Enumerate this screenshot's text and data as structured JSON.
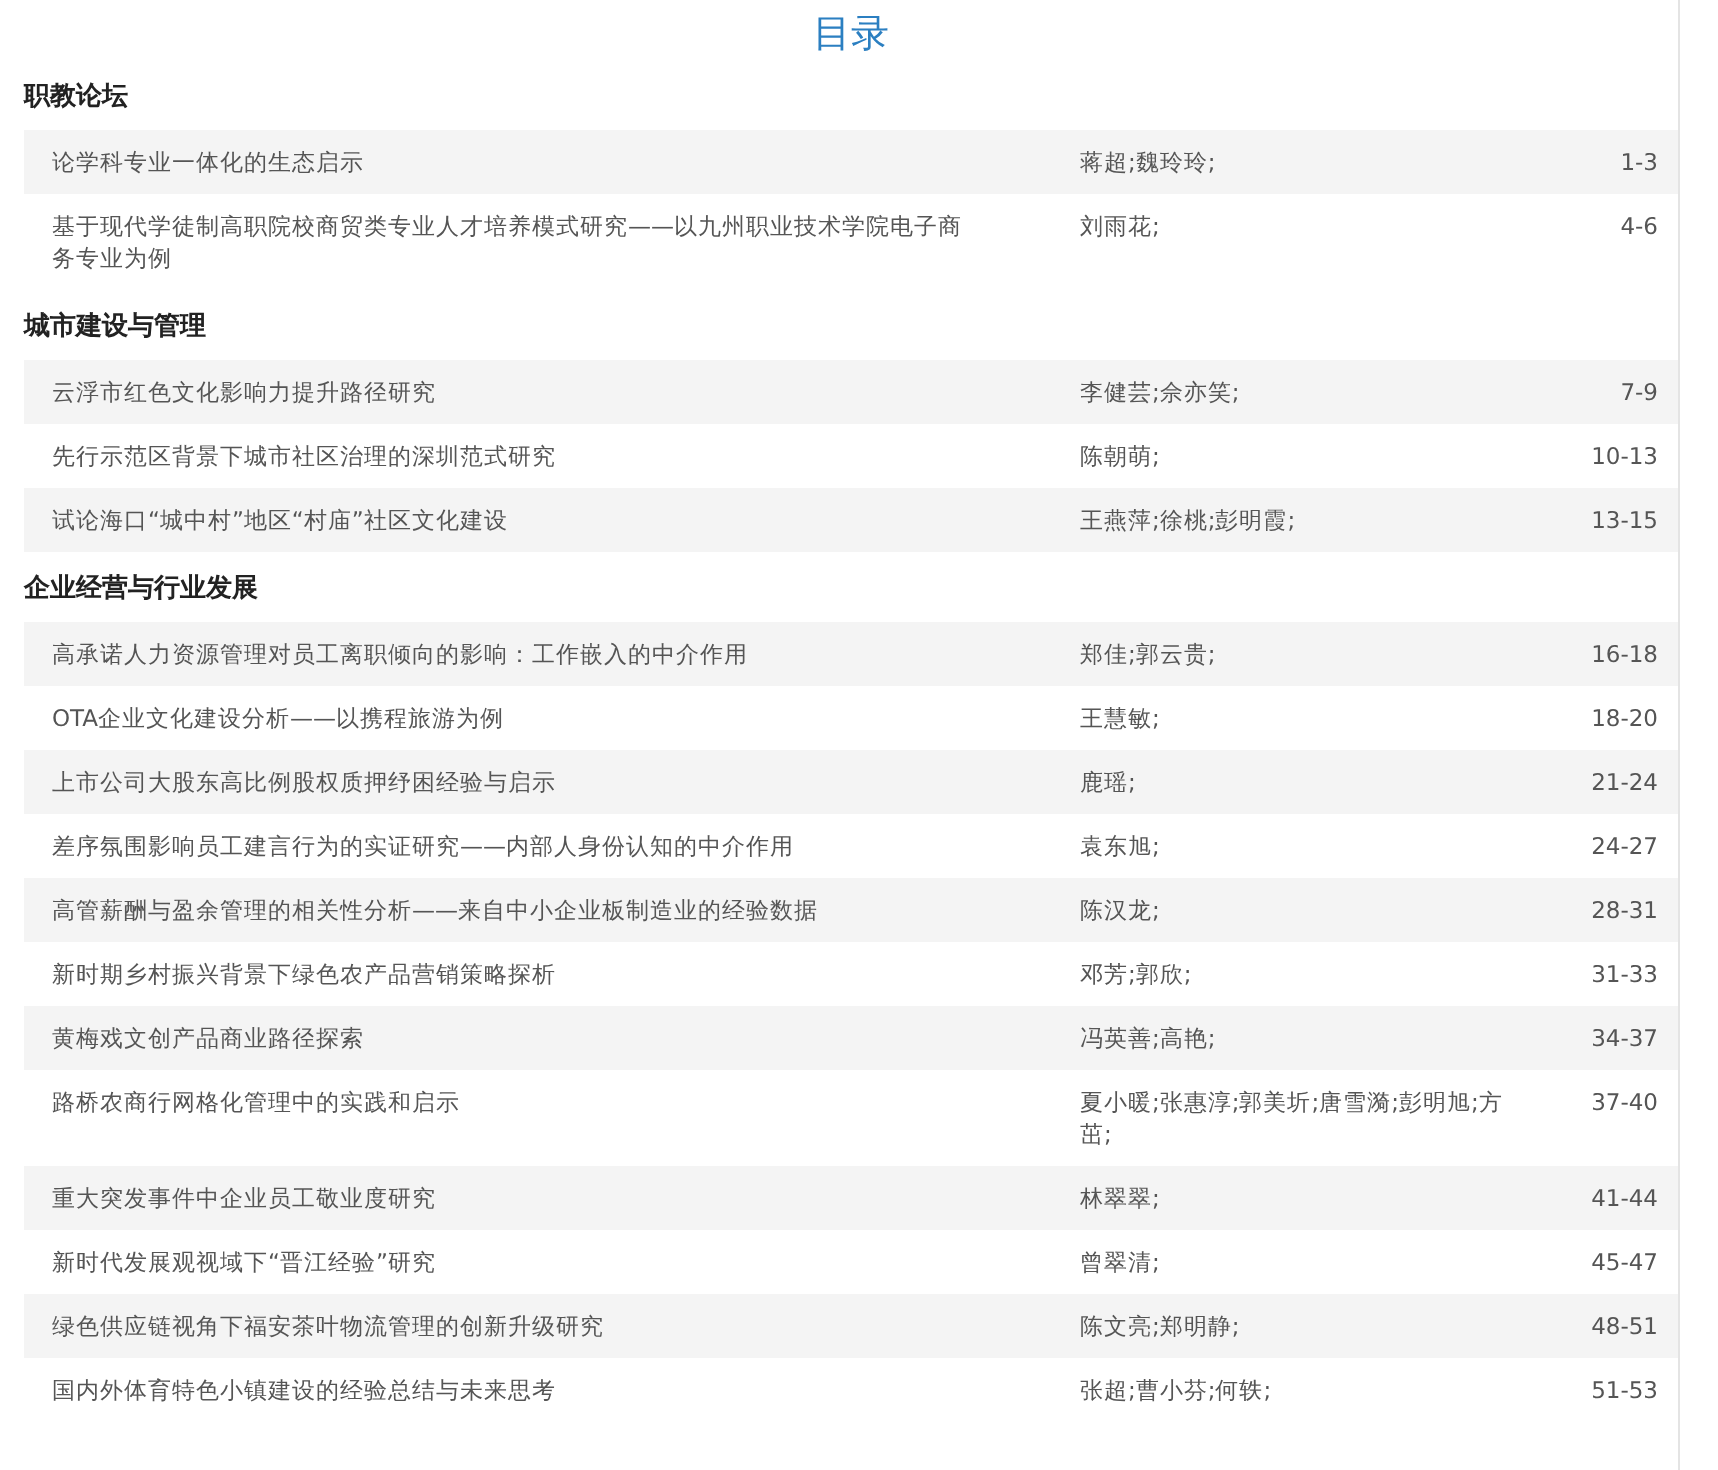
{
  "title": "目录",
  "sections": [
    {
      "heading": "职教论坛",
      "articles": [
        {
          "title": "论学科专业一体化的生态启示",
          "authors": "蒋超;魏玲玲;",
          "pages": "1-3"
        },
        {
          "title": "基于现代学徒制高职院校商贸类专业人才培养模式研究——以九州职业技术学院电子商务专业为例",
          "authors": "刘雨花;",
          "pages": "4-6"
        }
      ]
    },
    {
      "heading": "城市建设与管理",
      "articles": [
        {
          "title": "云浮市红色文化影响力提升路径研究",
          "authors": "李健芸;佘亦笑;",
          "pages": "7-9"
        },
        {
          "title": "先行示范区背景下城市社区治理的深圳范式研究",
          "authors": "陈朝萌;",
          "pages": "10-13"
        },
        {
          "title": "试论海口“城中村”地区“村庙”社区文化建设",
          "authors": "王燕萍;徐桃;彭明霞;",
          "pages": "13-15"
        }
      ]
    },
    {
      "heading": "企业经营与行业发展",
      "articles": [
        {
          "title": "高承诺人力资源管理对员工离职倾向的影响：工作嵌入的中介作用",
          "authors": "郑佳;郭云贵;",
          "pages": "16-18"
        },
        {
          "title": "OTA企业文化建设分析——以携程旅游为例",
          "authors": "王慧敏;",
          "pages": "18-20"
        },
        {
          "title": "上市公司大股东高比例股权质押纾困经验与启示",
          "authors": "鹿瑶;",
          "pages": "21-24"
        },
        {
          "title": "差序氛围影响员工建言行为的实证研究——内部人身份认知的中介作用",
          "authors": "袁东旭;",
          "pages": "24-27"
        },
        {
          "title": "高管薪酬与盈余管理的相关性分析——来自中小企业板制造业的经验数据",
          "authors": "陈汉龙;",
          "pages": "28-31"
        },
        {
          "title": "新时期乡村振兴背景下绿色农产品营销策略探析",
          "authors": "邓芳;郭欣;",
          "pages": "31-33"
        },
        {
          "title": "黄梅戏文创产品商业路径探索",
          "authors": "冯英善;高艳;",
          "pages": "34-37"
        },
        {
          "title": "路桥农商行网格化管理中的实践和启示",
          "authors": "夏小暖;张惠淳;郭美圻;唐雪漪;彭明旭;方茁;",
          "pages": "37-40"
        },
        {
          "title": "重大突发事件中企业员工敬业度研究",
          "authors": "林翠翠;",
          "pages": "41-44"
        },
        {
          "title": "新时代发展观视域下“晋江经验”研究",
          "authors": "曾翠清;",
          "pages": "45-47"
        },
        {
          "title": "绿色供应链视角下福安茶叶物流管理的创新升级研究",
          "authors": "陈文亮;郑明静;",
          "pages": "48-51"
        },
        {
          "title": "国内外体育特色小镇建设的经验总结与未来思考",
          "authors": "张超;曹小芬;何轶;",
          "pages": "51-53"
        }
      ]
    }
  ]
}
